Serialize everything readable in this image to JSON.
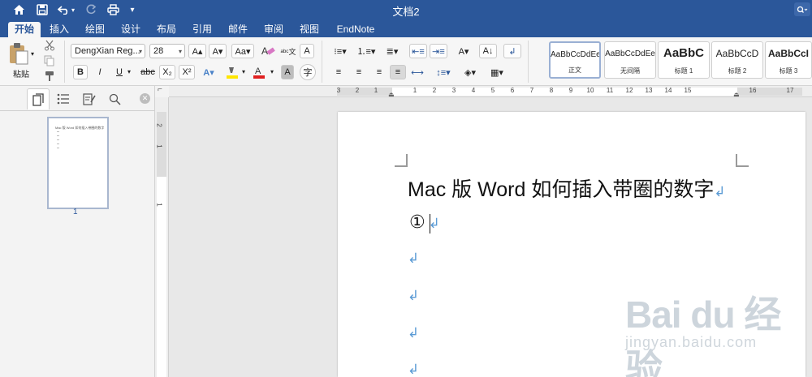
{
  "window": {
    "title": "文档2"
  },
  "ribbon_tabs": [
    "开始",
    "插入",
    "绘图",
    "设计",
    "布局",
    "引用",
    "邮件",
    "审阅",
    "视图",
    "EndNote"
  ],
  "active_tab": "开始",
  "clipboard": {
    "paste_label": "粘贴"
  },
  "font": {
    "family": "DengXian Reg...",
    "size": "28"
  },
  "format_buttons": {
    "bold": "B",
    "italic": "I",
    "underline": "U",
    "strike": "abc",
    "subscript": "X₂",
    "superscript": "X²"
  },
  "styles": [
    {
      "sample": "AaBbCcDdEe",
      "name": "正文",
      "active": true
    },
    {
      "sample": "AaBbCcDdEe",
      "name": "无间隔",
      "active": false
    },
    {
      "sample": "AaBbC",
      "name": "标题 1",
      "active": false
    },
    {
      "sample": "AaBbCcD",
      "name": "标题 2",
      "active": false
    },
    {
      "sample": "AaBbCcI",
      "name": "标题 3",
      "active": false
    }
  ],
  "sidepane": {
    "page_number": "1",
    "thumb_title": "Mac 版 Word 如何插入带圈的数字"
  },
  "ruler": {
    "h_numbers": [
      "3",
      "2",
      "1",
      "1",
      "2",
      "3",
      "4",
      "5",
      "6",
      "7",
      "8",
      "9",
      "10",
      "11",
      "12",
      "13",
      "14",
      "15",
      "16",
      "17"
    ],
    "v_numbers": [
      "2",
      "1",
      "1"
    ]
  },
  "document": {
    "title": "Mac 版 Word 如何插入带圈的数字",
    "circled_number": "①",
    "paragraph_mark": "↲"
  },
  "watermark": {
    "text": "Bai du 经验",
    "url": "jingyan.baidu.com"
  },
  "colors": {
    "brand": "#2b579a",
    "para_mark": "#5b9bd5",
    "font_color": "#e02020",
    "highlight": "#ffe600"
  }
}
